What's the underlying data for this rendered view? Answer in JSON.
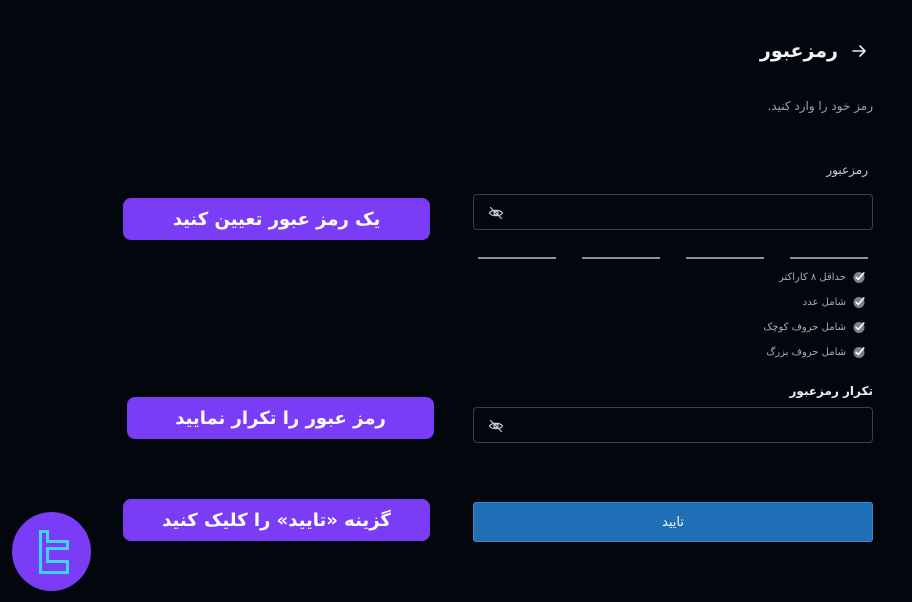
{
  "header": {
    "title": "رمزعبور"
  },
  "subtitle": "رمز خود را وارد کنید.",
  "password": {
    "label": "رمزعبور",
    "value": "",
    "placeholder": ""
  },
  "rules": [
    {
      "label": "حداقل ۸ کاراکتر"
    },
    {
      "label": "شامل عدد"
    },
    {
      "label": "شامل حروف کوچک"
    },
    {
      "label": "شامل حروف بزرگ"
    }
  ],
  "confirm": {
    "label": "تکرار رمزعبور",
    "value": "",
    "placeholder": ""
  },
  "submit": {
    "label": "تایید"
  },
  "callouts": {
    "set_password": "یک رمز عبور تعیین کنید",
    "repeat_password": "رمز عبور را تکرار نمایید",
    "click_confirm": "گزینه «تایید» را کلیک کنید"
  },
  "colors": {
    "background": "#03060d",
    "accent": "#1f6fb6",
    "callout": "#7b3cf5",
    "logo_mark": "#3ad6ff"
  }
}
